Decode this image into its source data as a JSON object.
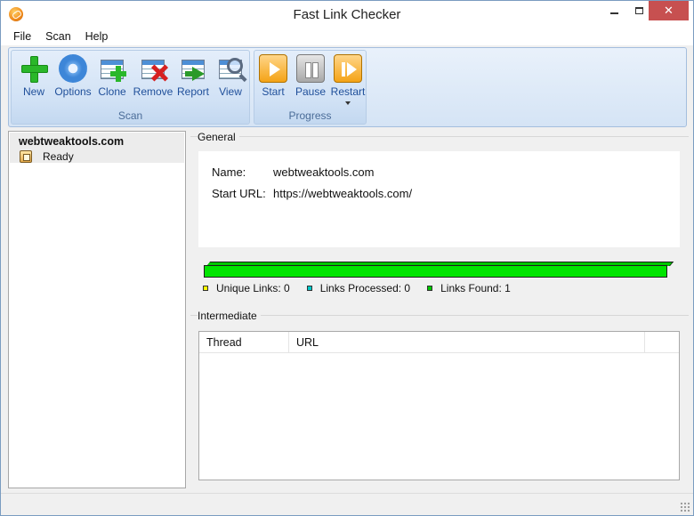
{
  "window": {
    "title": "Fast Link Checker",
    "close_glyph": "✕"
  },
  "menu": [
    "File",
    "Scan",
    "Help"
  ],
  "ribbon": {
    "scan_group": {
      "label": "Scan",
      "buttons": [
        {
          "label": "New",
          "icon": "plus-icon"
        },
        {
          "label": "Options",
          "icon": "gear-icon"
        },
        {
          "label": "Clone",
          "icon": "clone-icon"
        },
        {
          "label": "Remove",
          "icon": "remove-icon"
        },
        {
          "label": "Report",
          "icon": "report-icon"
        },
        {
          "label": "View",
          "icon": "view-icon"
        }
      ]
    },
    "progress_group": {
      "label": "Progress",
      "buttons": [
        {
          "label": "Start",
          "icon": "play-icon"
        },
        {
          "label": "Pause",
          "icon": "pause-icon"
        },
        {
          "label": "Restart",
          "icon": "restart-icon",
          "has_dropdown": true
        }
      ]
    }
  },
  "projects": [
    {
      "name": "webtweaktools.com",
      "status": "Ready"
    }
  ],
  "general": {
    "title": "General",
    "name_label": "Name:",
    "name_value": "webtweaktools.com",
    "url_label": "Start URL:",
    "url_value": "https://webtweaktools.com/"
  },
  "progress": {
    "fraction": 1.0,
    "color": "#00e500"
  },
  "legend": [
    {
      "label": "Unique Links: 0",
      "color": "#ffff00"
    },
    {
      "label": "Links Processed: 0",
      "color": "#00c8c8"
    },
    {
      "label": "Links Found: 1",
      "color": "#00c800"
    }
  ],
  "intermediate": {
    "title": "Intermediate",
    "columns": [
      "Thread",
      "URL"
    ]
  }
}
